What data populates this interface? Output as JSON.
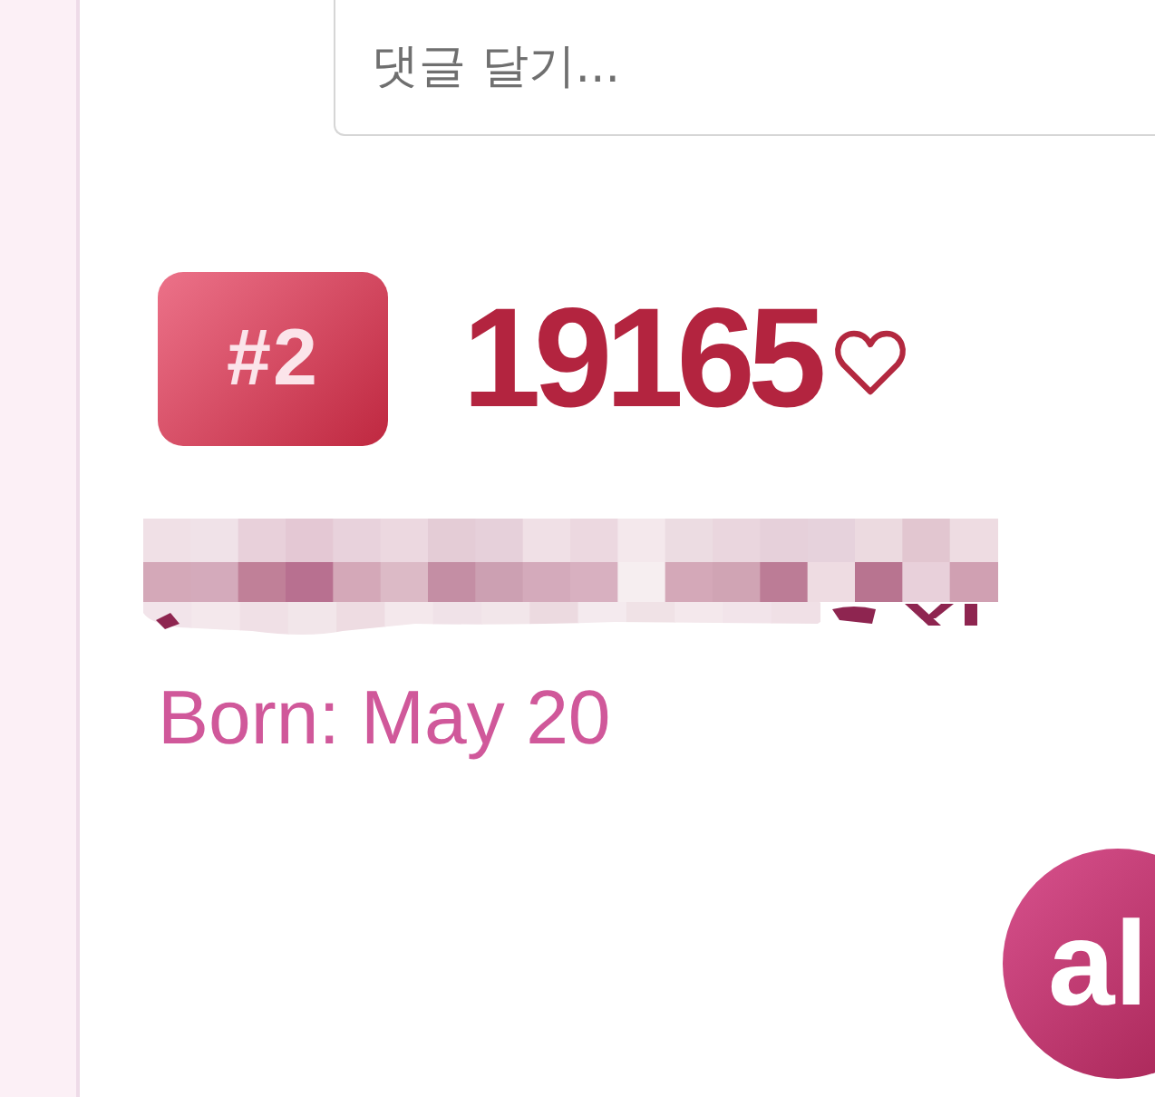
{
  "comment_field": {
    "placeholder": "댓글 달기..."
  },
  "entry": {
    "rank": "#2",
    "likes": "19165",
    "liked": false,
    "born": "Born: May 20"
  },
  "floating_badge": {
    "label": "al"
  }
}
